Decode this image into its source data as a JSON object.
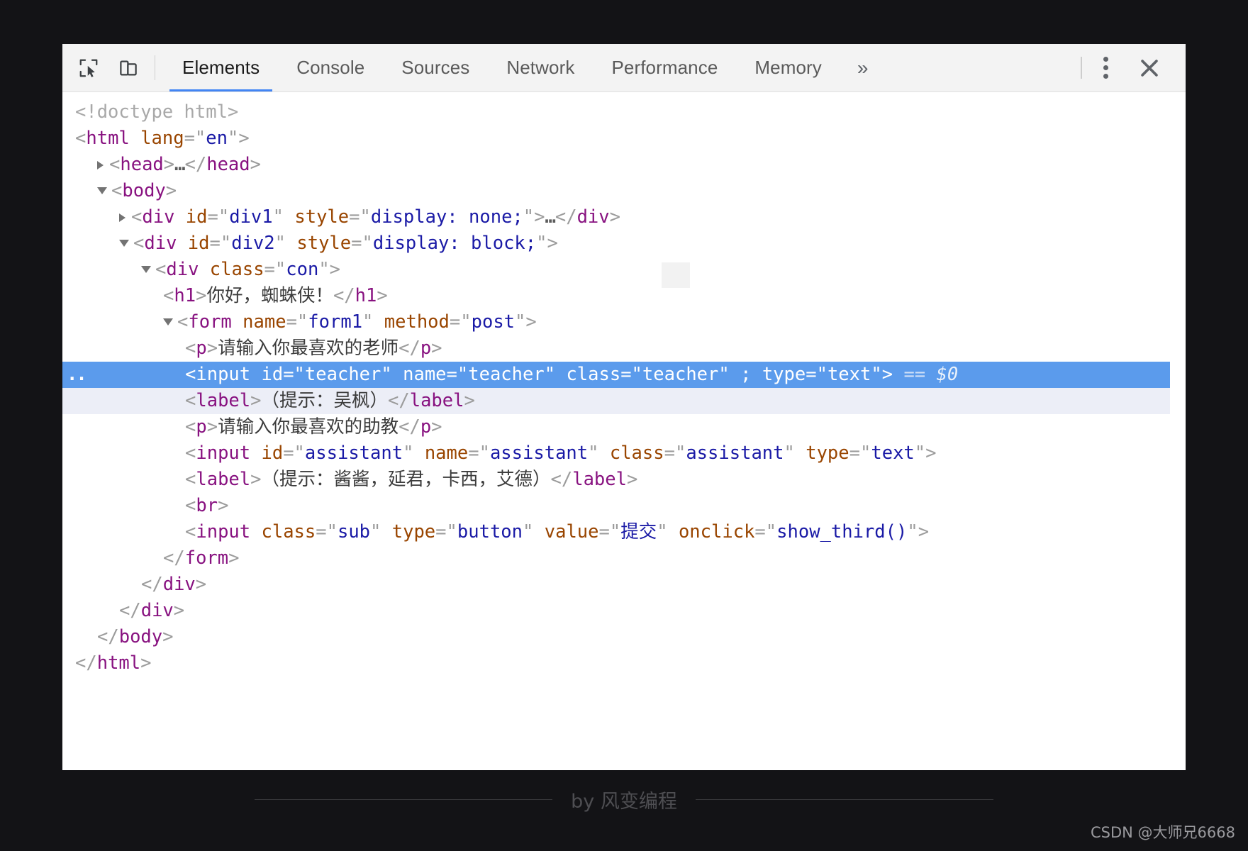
{
  "window": {
    "title": "Chrome DevTools"
  },
  "toolbar": {
    "inspect_icon": "inspect-cursor-icon",
    "device_icon": "device-toolbar-icon",
    "tabs": [
      {
        "label": "Elements",
        "active": true
      },
      {
        "label": "Console",
        "active": false
      },
      {
        "label": "Sources",
        "active": false
      },
      {
        "label": "Network",
        "active": false
      },
      {
        "label": "Performance",
        "active": false
      },
      {
        "label": "Memory",
        "active": false
      }
    ],
    "more_tabs_label": "»",
    "menu_icon": "kebab-menu-icon",
    "close_icon": "close-icon"
  },
  "colors": {
    "tag": "#881280",
    "attr_name": "#994500",
    "attr_value": "#1a1aa6",
    "punct": "#9c9c9c",
    "selection": "#5b9bec",
    "hover": "#eceef7",
    "tab_underline": "#4285f4",
    "toolbar_bg": "#f3f3f3",
    "page_bg": "#131316"
  },
  "dom_tree": {
    "lines": [
      {
        "id": "doctype",
        "indent": 0,
        "twisty": "none",
        "state": "normal",
        "parts": [
          {
            "c": "doctype",
            "t": "<!doctype html>"
          }
        ]
      },
      {
        "id": "html-open",
        "indent": 0,
        "twisty": "none",
        "state": "normal",
        "parts": [
          {
            "c": "punct",
            "t": "<"
          },
          {
            "c": "tag",
            "t": "html"
          },
          {
            "c": "punct",
            "t": " "
          },
          {
            "c": "attrname",
            "t": "lang"
          },
          {
            "c": "punct",
            "t": "=\""
          },
          {
            "c": "attrval",
            "t": "en"
          },
          {
            "c": "punct",
            "t": "\">"
          }
        ]
      },
      {
        "id": "head",
        "indent": 1,
        "twisty": "closed",
        "state": "normal",
        "parts": [
          {
            "c": "punct",
            "t": "<"
          },
          {
            "c": "tag",
            "t": "head"
          },
          {
            "c": "punct",
            "t": ">"
          },
          {
            "c": "ellipsis",
            "t": "…"
          },
          {
            "c": "punct",
            "t": "</"
          },
          {
            "c": "tag",
            "t": "head"
          },
          {
            "c": "punct",
            "t": ">"
          }
        ]
      },
      {
        "id": "body-open",
        "indent": 1,
        "twisty": "open",
        "state": "normal",
        "parts": [
          {
            "c": "punct",
            "t": "<"
          },
          {
            "c": "tag",
            "t": "body"
          },
          {
            "c": "punct",
            "t": ">"
          }
        ]
      },
      {
        "id": "div1",
        "indent": 2,
        "twisty": "closed",
        "state": "normal",
        "parts": [
          {
            "c": "punct",
            "t": "<"
          },
          {
            "c": "tag",
            "t": "div"
          },
          {
            "c": "punct",
            "t": " "
          },
          {
            "c": "attrname",
            "t": "id"
          },
          {
            "c": "punct",
            "t": "=\""
          },
          {
            "c": "attrval",
            "t": "div1"
          },
          {
            "c": "punct",
            "t": "\" "
          },
          {
            "c": "attrname",
            "t": "style"
          },
          {
            "c": "punct",
            "t": "=\""
          },
          {
            "c": "attrval",
            "t": "display: none;"
          },
          {
            "c": "punct",
            "t": "\">"
          },
          {
            "c": "ellipsis",
            "t": "…"
          },
          {
            "c": "punct",
            "t": "</"
          },
          {
            "c": "tag",
            "t": "div"
          },
          {
            "c": "punct",
            "t": ">"
          }
        ]
      },
      {
        "id": "div2",
        "indent": 2,
        "twisty": "open",
        "state": "normal",
        "parts": [
          {
            "c": "punct",
            "t": "<"
          },
          {
            "c": "tag",
            "t": "div"
          },
          {
            "c": "punct",
            "t": " "
          },
          {
            "c": "attrname",
            "t": "id"
          },
          {
            "c": "punct",
            "t": "=\""
          },
          {
            "c": "attrval",
            "t": "div2"
          },
          {
            "c": "punct",
            "t": "\" "
          },
          {
            "c": "attrname",
            "t": "style"
          },
          {
            "c": "punct",
            "t": "=\""
          },
          {
            "c": "attrval",
            "t": "display: block;"
          },
          {
            "c": "punct",
            "t": "\">"
          }
        ]
      },
      {
        "id": "div-con",
        "indent": 3,
        "twisty": "open",
        "state": "normal",
        "parts": [
          {
            "c": "punct",
            "t": "<"
          },
          {
            "c": "tag",
            "t": "div"
          },
          {
            "c": "punct",
            "t": " "
          },
          {
            "c": "attrname",
            "t": "class"
          },
          {
            "c": "punct",
            "t": "=\""
          },
          {
            "c": "attrval",
            "t": "con"
          },
          {
            "c": "punct",
            "t": "\">"
          }
        ]
      },
      {
        "id": "h1",
        "indent": 4,
        "twisty": "none",
        "state": "normal",
        "parts": [
          {
            "c": "punct",
            "t": "<"
          },
          {
            "c": "tag",
            "t": "h1"
          },
          {
            "c": "punct",
            "t": ">"
          },
          {
            "c": "text",
            "t": "你好，蜘蛛侠！"
          },
          {
            "c": "punct",
            "t": "</"
          },
          {
            "c": "tag",
            "t": "h1"
          },
          {
            "c": "punct",
            "t": ">"
          }
        ]
      },
      {
        "id": "form",
        "indent": 4,
        "twisty": "open",
        "state": "normal",
        "parts": [
          {
            "c": "punct",
            "t": "<"
          },
          {
            "c": "tag",
            "t": "form"
          },
          {
            "c": "punct",
            "t": " "
          },
          {
            "c": "attrname",
            "t": "name"
          },
          {
            "c": "punct",
            "t": "=\""
          },
          {
            "c": "attrval",
            "t": "form1"
          },
          {
            "c": "punct",
            "t": "\" "
          },
          {
            "c": "attrname",
            "t": "method"
          },
          {
            "c": "punct",
            "t": "=\""
          },
          {
            "c": "attrval",
            "t": "post"
          },
          {
            "c": "punct",
            "t": "\">"
          }
        ]
      },
      {
        "id": "p-teacher",
        "indent": 5,
        "twisty": "none",
        "state": "normal",
        "parts": [
          {
            "c": "punct",
            "t": "<"
          },
          {
            "c": "tag",
            "t": "p"
          },
          {
            "c": "punct",
            "t": ">"
          },
          {
            "c": "text",
            "t": "请输入你最喜欢的老师"
          },
          {
            "c": "punct",
            "t": "</"
          },
          {
            "c": "tag",
            "t": "p"
          },
          {
            "c": "punct",
            "t": ">"
          }
        ]
      },
      {
        "id": "input-teacher",
        "indent": 5,
        "twisty": "none",
        "state": "selected",
        "parts": [
          {
            "c": "punct",
            "t": "<"
          },
          {
            "c": "tag",
            "t": "input"
          },
          {
            "c": "punct",
            "t": " "
          },
          {
            "c": "attrname",
            "t": "id"
          },
          {
            "c": "punct",
            "t": "=\""
          },
          {
            "c": "attrval",
            "t": "teacher"
          },
          {
            "c": "punct",
            "t": "\" "
          },
          {
            "c": "attrname",
            "t": "name"
          },
          {
            "c": "punct",
            "t": "=\""
          },
          {
            "c": "attrval",
            "t": "teacher"
          },
          {
            "c": "punct",
            "t": "\" "
          },
          {
            "c": "attrname",
            "t": "class"
          },
          {
            "c": "punct",
            "t": "=\""
          },
          {
            "c": "attrval",
            "t": "teacher"
          },
          {
            "c": "punct",
            "t": "\" ; "
          },
          {
            "c": "attrname",
            "t": "type"
          },
          {
            "c": "punct",
            "t": "=\""
          },
          {
            "c": "attrval",
            "t": "text"
          },
          {
            "c": "punct",
            "t": "\">"
          },
          {
            "c": "eq",
            "t": " == "
          },
          {
            "c": "dollar",
            "t": "$0"
          }
        ]
      },
      {
        "id": "label-teacher",
        "indent": 5,
        "twisty": "none",
        "state": "hover",
        "parts": [
          {
            "c": "punct",
            "t": "<"
          },
          {
            "c": "tag",
            "t": "label"
          },
          {
            "c": "punct",
            "t": ">"
          },
          {
            "c": "text",
            "t": "（提示：吴枫）"
          },
          {
            "c": "punct",
            "t": "</"
          },
          {
            "c": "tag",
            "t": "label"
          },
          {
            "c": "punct",
            "t": ">"
          }
        ]
      },
      {
        "id": "p-assistant",
        "indent": 5,
        "twisty": "none",
        "state": "normal",
        "parts": [
          {
            "c": "punct",
            "t": "<"
          },
          {
            "c": "tag",
            "t": "p"
          },
          {
            "c": "punct",
            "t": ">"
          },
          {
            "c": "text",
            "t": "请输入你最喜欢的助教"
          },
          {
            "c": "punct",
            "t": "</"
          },
          {
            "c": "tag",
            "t": "p"
          },
          {
            "c": "punct",
            "t": ">"
          }
        ]
      },
      {
        "id": "input-assistant",
        "indent": 5,
        "twisty": "none",
        "state": "normal",
        "parts": [
          {
            "c": "punct",
            "t": "<"
          },
          {
            "c": "tag",
            "t": "input"
          },
          {
            "c": "punct",
            "t": " "
          },
          {
            "c": "attrname",
            "t": "id"
          },
          {
            "c": "punct",
            "t": "=\""
          },
          {
            "c": "attrval",
            "t": "assistant"
          },
          {
            "c": "punct",
            "t": "\" "
          },
          {
            "c": "attrname",
            "t": "name"
          },
          {
            "c": "punct",
            "t": "=\""
          },
          {
            "c": "attrval",
            "t": "assistant"
          },
          {
            "c": "punct",
            "t": "\" "
          },
          {
            "c": "attrname",
            "t": "class"
          },
          {
            "c": "punct",
            "t": "=\""
          },
          {
            "c": "attrval",
            "t": "assistant"
          },
          {
            "c": "punct",
            "t": "\" "
          },
          {
            "c": "attrname",
            "t": "type"
          },
          {
            "c": "punct",
            "t": "=\""
          },
          {
            "c": "attrval",
            "t": "text"
          },
          {
            "c": "punct",
            "t": "\">"
          }
        ]
      },
      {
        "id": "label-assistant",
        "indent": 5,
        "twisty": "none",
        "state": "normal",
        "parts": [
          {
            "c": "punct",
            "t": "<"
          },
          {
            "c": "tag",
            "t": "label"
          },
          {
            "c": "punct",
            "t": ">"
          },
          {
            "c": "text",
            "t": "（提示：酱酱，延君，卡西，艾德）"
          },
          {
            "c": "punct",
            "t": "</"
          },
          {
            "c": "tag",
            "t": "label"
          },
          {
            "c": "punct",
            "t": ">"
          }
        ]
      },
      {
        "id": "br",
        "indent": 5,
        "twisty": "none",
        "state": "normal",
        "parts": [
          {
            "c": "punct",
            "t": "<"
          },
          {
            "c": "tag",
            "t": "br"
          },
          {
            "c": "punct",
            "t": ">"
          }
        ]
      },
      {
        "id": "input-sub",
        "indent": 5,
        "twisty": "none",
        "state": "normal",
        "parts": [
          {
            "c": "punct",
            "t": "<"
          },
          {
            "c": "tag",
            "t": "input"
          },
          {
            "c": "punct",
            "t": " "
          },
          {
            "c": "attrname",
            "t": "class"
          },
          {
            "c": "punct",
            "t": "=\""
          },
          {
            "c": "attrval",
            "t": "sub"
          },
          {
            "c": "punct",
            "t": "\" "
          },
          {
            "c": "attrname",
            "t": "type"
          },
          {
            "c": "punct",
            "t": "=\""
          },
          {
            "c": "attrval",
            "t": "button"
          },
          {
            "c": "punct",
            "t": "\" "
          },
          {
            "c": "attrname",
            "t": "value"
          },
          {
            "c": "punct",
            "t": "=\""
          },
          {
            "c": "attrval",
            "t": "提交"
          },
          {
            "c": "punct",
            "t": "\" "
          },
          {
            "c": "attrname",
            "t": "onclick"
          },
          {
            "c": "punct",
            "t": "=\""
          },
          {
            "c": "attrval",
            "t": "show_third()"
          },
          {
            "c": "punct",
            "t": "\">"
          }
        ]
      },
      {
        "id": "form-close",
        "indent": 4,
        "twisty": "none",
        "state": "normal",
        "parts": [
          {
            "c": "punct",
            "t": "</"
          },
          {
            "c": "tag",
            "t": "form"
          },
          {
            "c": "punct",
            "t": ">"
          }
        ]
      },
      {
        "id": "div-con-close",
        "indent": 3,
        "twisty": "none",
        "state": "normal",
        "parts": [
          {
            "c": "punct",
            "t": "</"
          },
          {
            "c": "tag",
            "t": "div"
          },
          {
            "c": "punct",
            "t": ">"
          }
        ]
      },
      {
        "id": "div2-close",
        "indent": 2,
        "twisty": "none",
        "state": "normal",
        "parts": [
          {
            "c": "punct",
            "t": "</"
          },
          {
            "c": "tag",
            "t": "div"
          },
          {
            "c": "punct",
            "t": ">"
          }
        ]
      },
      {
        "id": "body-close",
        "indent": 1,
        "twisty": "none",
        "state": "normal",
        "parts": [
          {
            "c": "punct",
            "t": "</"
          },
          {
            "c": "tag",
            "t": "body"
          },
          {
            "c": "punct",
            "t": ">"
          }
        ]
      },
      {
        "id": "html-close",
        "indent": 0,
        "twisty": "none",
        "state": "normal",
        "parts": [
          {
            "c": "punct",
            "t": "</"
          },
          {
            "c": "tag",
            "t": "html"
          },
          {
            "c": "punct",
            "t": ">"
          }
        ]
      }
    ],
    "selected_marker": ".."
  },
  "footer": {
    "byline": "by 风变编程",
    "watermark": "CSDN @大师兄6668"
  }
}
